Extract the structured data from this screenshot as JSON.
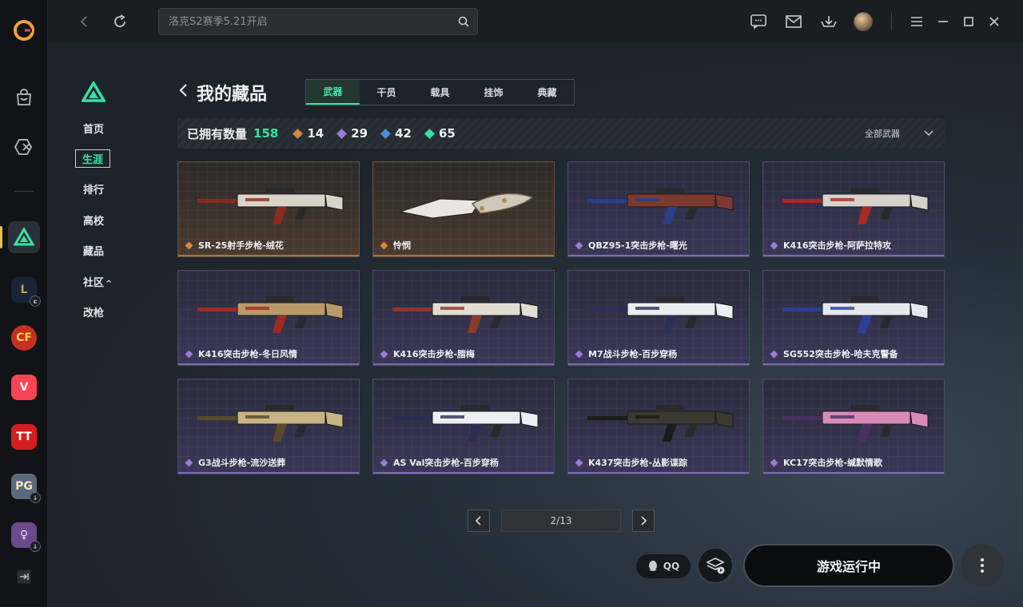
{
  "topbar": {
    "search_placeholder": "洛克S2赛季5.21开启"
  },
  "rail": {
    "games": [
      {
        "label": "L",
        "bg": "#1a2438",
        "fg": "#c9a24a"
      },
      {
        "label": "CF",
        "bg": "#c43024",
        "fg": "#ffd24a"
      },
      {
        "label": "V",
        "bg": "#fa4454",
        "fg": "#ffffff"
      },
      {
        "label": "TT",
        "bg": "#d51f1f",
        "fg": "#ffffff"
      },
      {
        "label": "PG",
        "bg": "#5b6a7a",
        "fg": "#f2e3c4"
      },
      {
        "label": "♀",
        "bg": "#6a4a8a",
        "fg": "#f3d7f2"
      }
    ]
  },
  "subnav": {
    "items": [
      "首页",
      "生涯",
      "排行",
      "高校",
      "藏品",
      "社区",
      "改枪"
    ],
    "community_suffix": "^"
  },
  "page": {
    "title": "我的藏品",
    "tabs": [
      "武器",
      "干员",
      "载具",
      "挂饰",
      "典藏"
    ]
  },
  "stats": {
    "label": "已拥有数量",
    "total": "158",
    "counts": [
      {
        "value": "14",
        "color": "#d7873f"
      },
      {
        "value": "29",
        "color": "#9b7bd8"
      },
      {
        "value": "42",
        "color": "#4a8ed8"
      },
      {
        "value": "65",
        "color": "#35e3a1"
      }
    ],
    "filter_label": "全部武器"
  },
  "cards": [
    {
      "name": "SR-25射手步枪-绒花",
      "rarity": "gold",
      "gem": "#d7873f",
      "body": "#d9d3c8",
      "accent": "#8a2a20"
    },
    {
      "name": "怜悯",
      "rarity": "gold",
      "gem": "#d7873f",
      "body": "#e8e6e0",
      "accent": "#b08a4a"
    },
    {
      "name": "QBZ95-1突击步枪-曙光",
      "rarity": "purple",
      "gem": "#9b7bd8",
      "body": "#7a3a2e",
      "accent": "#2a3e8a"
    },
    {
      "name": "K416突击步枪-阿萨拉特攻",
      "rarity": "purple",
      "gem": "#9b7bd8",
      "body": "#d6d2cc",
      "accent": "#a82a22"
    },
    {
      "name": "K416突击步枪-冬日风情",
      "rarity": "purple",
      "gem": "#9b7bd8",
      "body": "#b99a6a",
      "accent": "#a02a22"
    },
    {
      "name": "K416突击步枪-腊梅",
      "rarity": "purple",
      "gem": "#9b7bd8",
      "body": "#e2ddd2",
      "accent": "#8a3a2a"
    },
    {
      "name": "M7战斗步枪-百步穿杨",
      "rarity": "purple",
      "gem": "#9b7bd8",
      "body": "#eceef2",
      "accent": "#2a3058"
    },
    {
      "name": "SG552突击步枪-哈夫克警备",
      "rarity": "purple",
      "gem": "#9b7bd8",
      "body": "#e6e8ee",
      "accent": "#2d3f9a"
    },
    {
      "name": "G3战斗步枪-流沙送葬",
      "rarity": "purple",
      "gem": "#9b7bd8",
      "body": "#c6b484",
      "accent": "#5a4a2a"
    },
    {
      "name": "AS Val突击步枪-百步穿杨",
      "rarity": "purple",
      "gem": "#9b7bd8",
      "body": "#eceef2",
      "accent": "#2a2f52"
    },
    {
      "name": "K437突击步枪-丛影谍踪",
      "rarity": "purple",
      "gem": "#9b7bd8",
      "body": "#3a3a30",
      "accent": "#1c1c18"
    },
    {
      "name": "KC17突击步枪-缄默情歌",
      "rarity": "purple",
      "gem": "#9b7bd8",
      "body": "#d88ab8",
      "accent": "#4a3060"
    }
  ],
  "pager": {
    "current": "2/13"
  },
  "bottom": {
    "qq_label": "QQ",
    "run_label": "游戏运行中"
  }
}
